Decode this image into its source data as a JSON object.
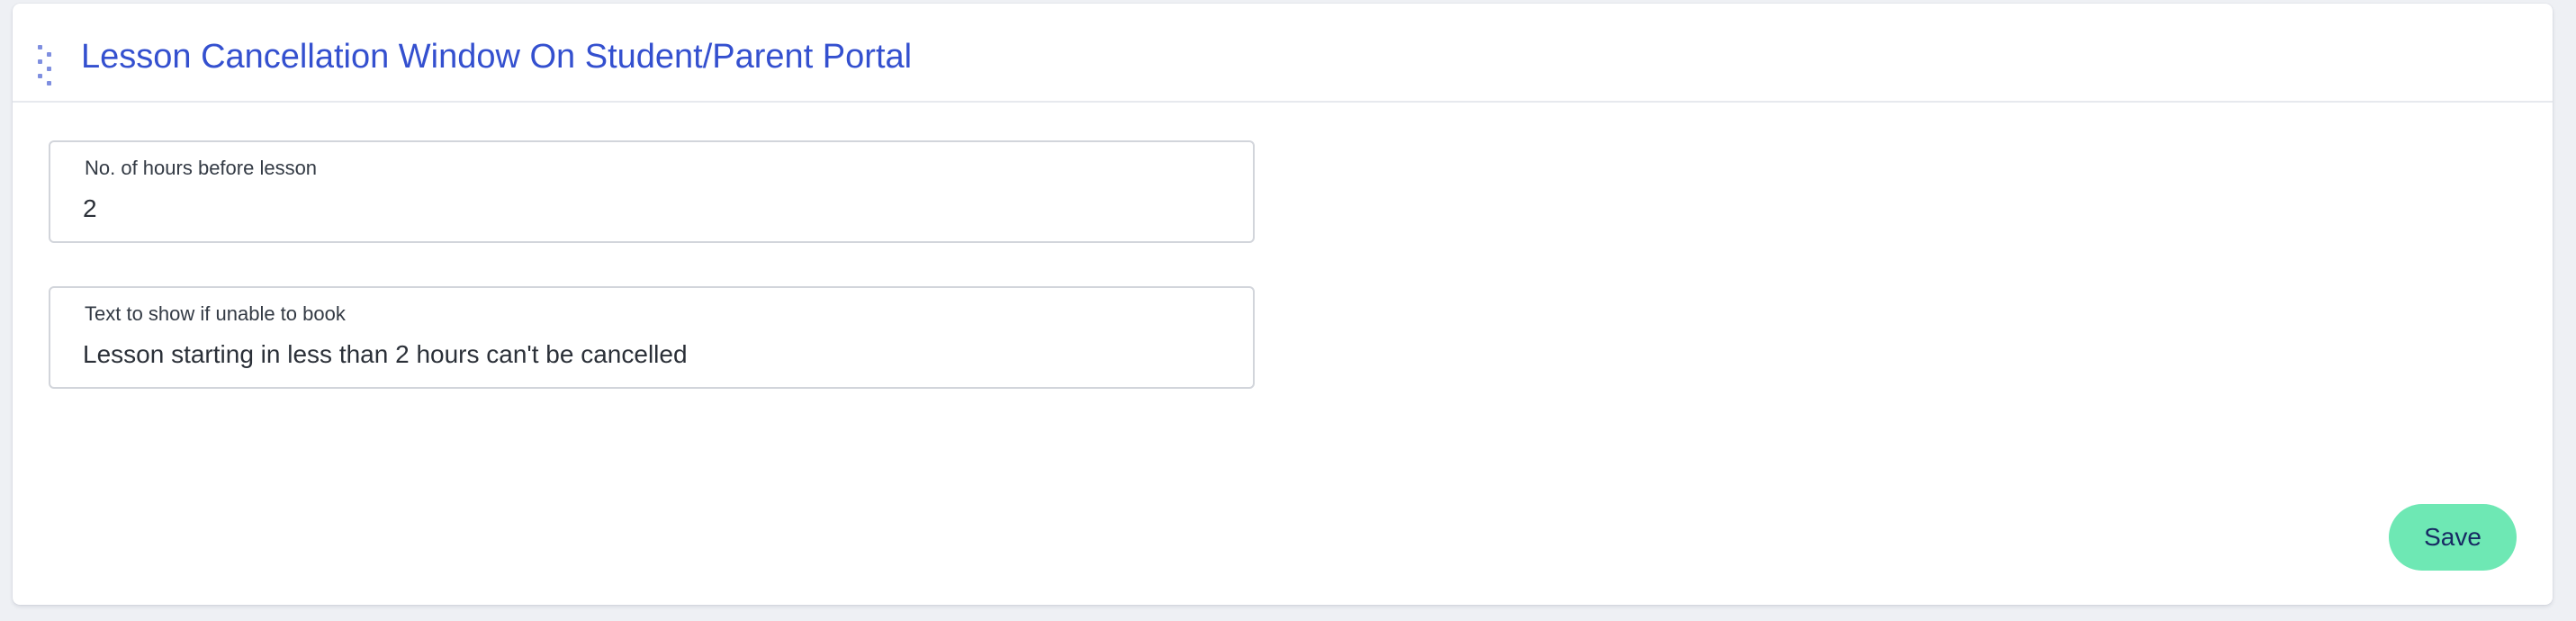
{
  "card": {
    "title": "Lesson Cancellation Window On Student/Parent Portal"
  },
  "fields": [
    {
      "label": "No. of hours before lesson",
      "value": "2"
    },
    {
      "label": "Text to show if unable to book",
      "value": "Lesson starting in less than 2 hours can't be cancelled"
    }
  ],
  "actions": {
    "save_label": "Save"
  },
  "icons": {
    "drag_handle": "drag-handle-icon"
  },
  "colors": {
    "title": "#3450cf",
    "save_button": "#6ee8b4",
    "save_text": "#172a63"
  }
}
